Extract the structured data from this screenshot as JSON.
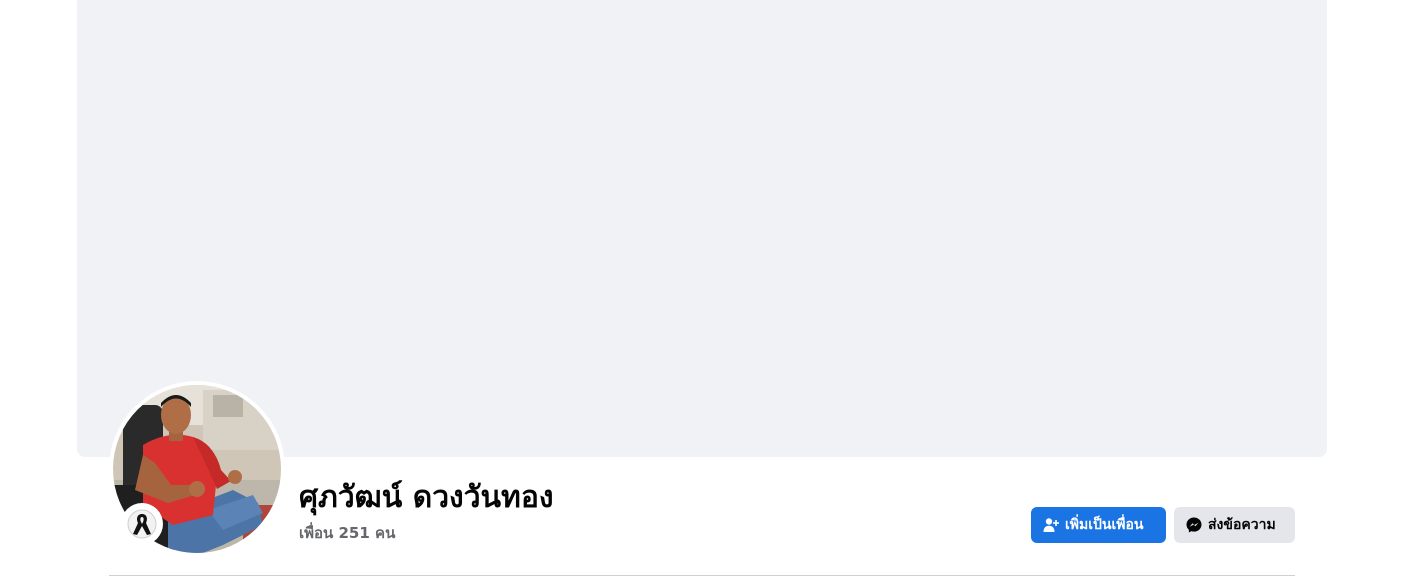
{
  "profile": {
    "name": "ศุภวัฒน์ ดวงวันทอง",
    "friends_text": "เพื่อน 251 คน"
  },
  "actions": {
    "add_friend_label": "เพิ่มเป็นเพื่อน",
    "message_label": "ส่งข้อความ"
  },
  "icons": {
    "add_friend": "person-plus-icon",
    "message": "messenger-icon",
    "ribbon": "mourning-ribbon-icon"
  },
  "colors": {
    "primary": "#1b74e4",
    "secondary_button": "#e4e6eb",
    "cover_placeholder": "#f0f2f5",
    "secondary_text": "#65676b"
  }
}
